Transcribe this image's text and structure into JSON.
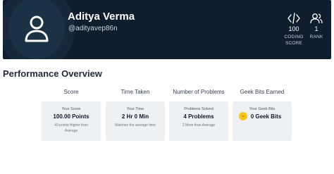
{
  "profile": {
    "name": "Aditya Verma",
    "handle": "@adityavep86n",
    "avatar_icon": "user-icon"
  },
  "stats": {
    "coding_score": {
      "value": "100",
      "label_line1": "CODING",
      "label_line2": "SCORE",
      "icon": "code-icon"
    },
    "rank": {
      "value": "1",
      "label": "RANK",
      "icon": "users-icon"
    }
  },
  "overview": {
    "title": "Performance Overview",
    "score": {
      "header": "Score",
      "caption": "Your Score",
      "value": "100.00 Points",
      "sub": "43 points Higher than Average"
    },
    "time": {
      "header": "Time Taken",
      "caption": "Your Time",
      "value": "2 Hr 0 Min",
      "sub": "Matches the average time"
    },
    "problems": {
      "header": "Number of Problems",
      "caption": "Problems Solved",
      "value": "4 Problems",
      "sub": "2 More than Average"
    },
    "geekbits": {
      "header": "Geek Bits Earned",
      "caption": "Your Geek Bits",
      "value": "0 Geek Bits",
      "icon": "coin-icon"
    }
  },
  "colors": {
    "header_bg": "#0f1e2c",
    "card_bg": "#eef1f4",
    "coin": "#f5c518"
  }
}
